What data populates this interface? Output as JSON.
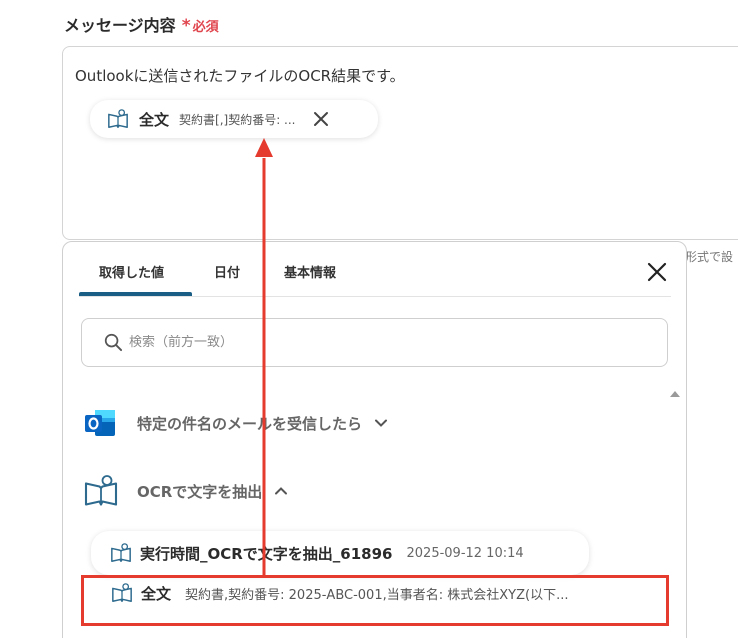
{
  "field": {
    "label": "メッセージ内容",
    "required_star": "*",
    "required_text": "必須",
    "message_text": "Outlookに送信されたファイルのOCR結果です。",
    "chip_title": "全文",
    "chip_value": "契約書[,]契約番号: ...",
    "side_hint": "形式で設"
  },
  "panel": {
    "tabs": [
      {
        "label": "取得した値",
        "active": true
      },
      {
        "label": "日付",
        "active": false
      },
      {
        "label": "基本情報",
        "active": false
      }
    ],
    "search_placeholder": "検索（前方一致）",
    "sections": [
      {
        "label": "特定の件名のメールを受信したら",
        "expanded": false,
        "icon": "outlook-icon"
      },
      {
        "label": "OCRで文字を抽出",
        "expanded": true,
        "icon": "book-icon"
      }
    ],
    "items": [
      {
        "title": "実行時間_OCRで文字を抽出_61896",
        "value": "2025-09-12 10:14"
      },
      {
        "title": "全文",
        "value": "契約書,契約番号: 2025-ABC-001,当事者名: 株式会社XYZ(以下..."
      }
    ]
  },
  "colors": {
    "accent": "#1a5e86",
    "required": "#e0454e",
    "annotation": "#e53a2e",
    "outlook_blue": "#0a64c2"
  }
}
